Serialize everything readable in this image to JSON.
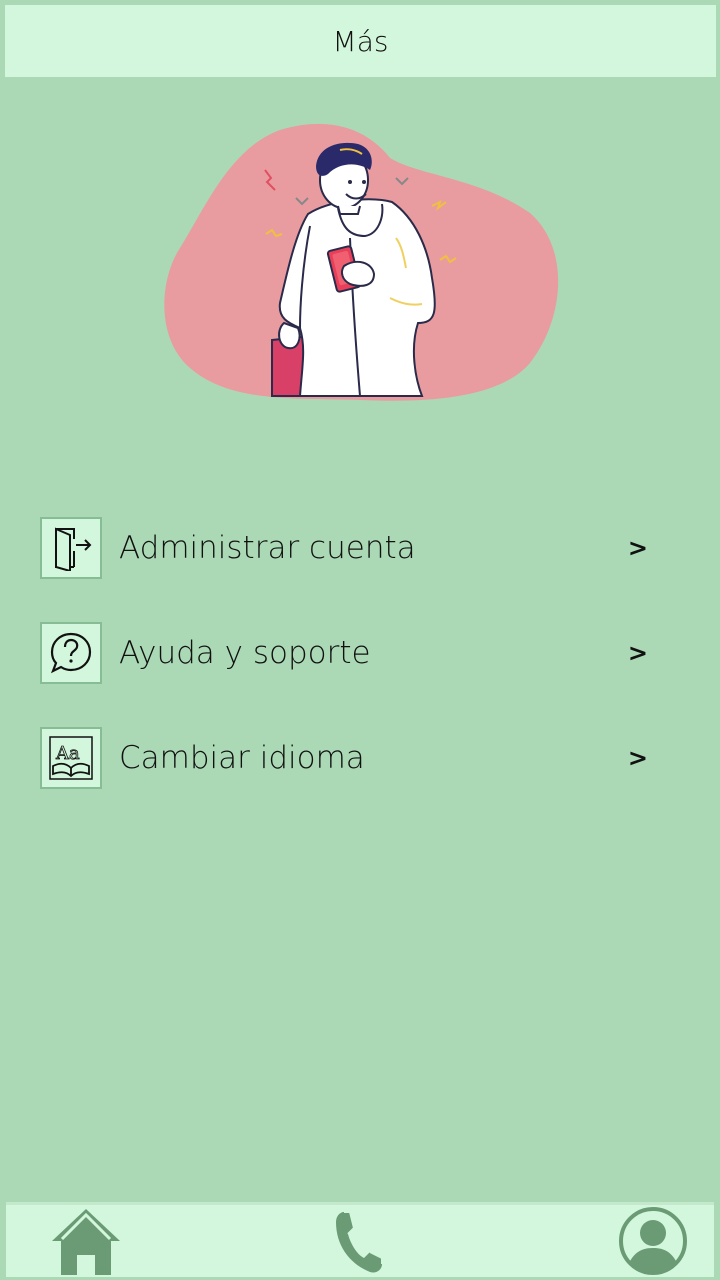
{
  "header": {
    "title": "Más"
  },
  "menu": {
    "items": [
      {
        "label": "Administrar cuenta",
        "chevron": ">",
        "icon": "door-exit-icon"
      },
      {
        "label": "Ayuda y soporte",
        "chevron": ">",
        "icon": "help-question-icon"
      },
      {
        "label": "Cambiar idioma",
        "chevron": ">",
        "icon": "language-book-icon"
      }
    ]
  },
  "bottom_nav": {
    "items": [
      {
        "icon": "home-icon"
      },
      {
        "icon": "phone-icon"
      },
      {
        "icon": "user-profile-icon"
      }
    ]
  },
  "colors": {
    "background": "#abd9b5",
    "header_bg": "#d3f7dc",
    "accent_dark": "#6a9b75",
    "blob_pink": "#e89ca0"
  }
}
